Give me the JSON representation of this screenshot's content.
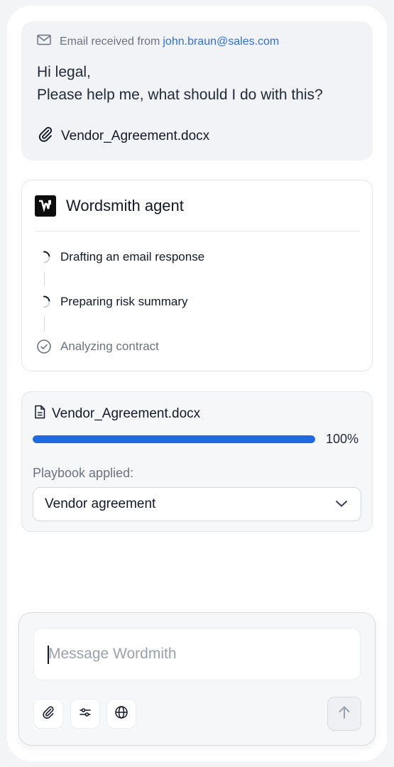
{
  "email": {
    "prefix": "Email received from",
    "sender": "john.braun@sales.com",
    "greeting": "Hi legal,",
    "message": "Please help me, what should I do with this?",
    "attachment": "Vendor_Agreement.docx"
  },
  "agent": {
    "title": "Wordsmith agent",
    "steps": [
      {
        "label": "Drafting an email response",
        "status": "in-progress"
      },
      {
        "label": "Preparing risk summary",
        "status": "in-progress"
      },
      {
        "label": "Analyzing contract",
        "status": "done"
      }
    ]
  },
  "document": {
    "filename": "Vendor_Agreement.docx",
    "progress_fraction": 1.0,
    "progress_label": "100%",
    "playbook_label": "Playbook applied:",
    "playbook_value": "Vendor agreement"
  },
  "composer": {
    "placeholder": "Message Wordmith"
  },
  "colors": {
    "accent": "#1f6ae0",
    "link": "#2f6fdb"
  },
  "icons": [
    "mail-icon",
    "paperclip-icon",
    "wordsmith-logo",
    "spinner-icon",
    "check-circle-icon",
    "document-icon",
    "chevron-down-icon",
    "sliders-icon",
    "globe-icon",
    "arrow-up-icon"
  ]
}
